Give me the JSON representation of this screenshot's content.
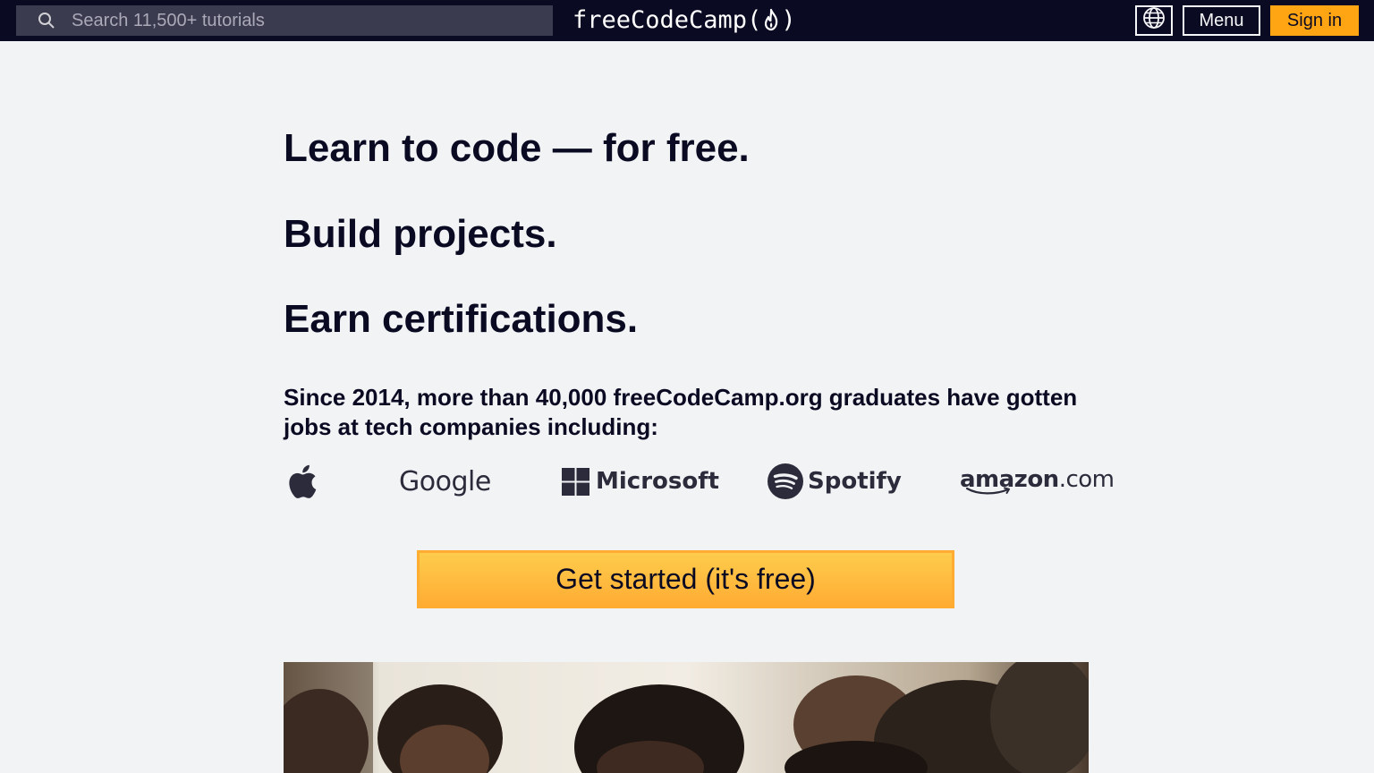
{
  "nav": {
    "search": {
      "placeholder": "Search 11,500+ tutorials",
      "value": ""
    },
    "brand": {
      "name": "freeCodeCamp",
      "open_paren": "(",
      "close_paren": ")"
    },
    "menu_label": "Menu",
    "signin_label": "Sign in"
  },
  "hero": {
    "headline_1": "Learn to code — for free.",
    "headline_2": "Build projects.",
    "headline_3": "Earn certifications.",
    "since_text": "Since 2014, more than 40,000 freeCodeCamp.org graduates have gotten jobs at tech companies including:",
    "companies": {
      "google": "Google",
      "microsoft": "Microsoft",
      "spotify": "Spotify",
      "amazon": "amazon",
      "amazon_suffix": ".com"
    },
    "cta_label": "Get started (it's free)"
  },
  "colors": {
    "navbar_bg": "#0a0a23",
    "page_bg": "#f2f3f5",
    "accent": "#ffa514",
    "text_dark": "#0a0a23"
  }
}
